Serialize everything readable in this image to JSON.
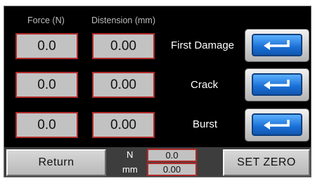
{
  "headers": {
    "force": "Force (N)",
    "distension": "Distension (mm)"
  },
  "rows": [
    {
      "force": "0.0",
      "distension": "0.00",
      "label": "First Damage"
    },
    {
      "force": "0.0",
      "distension": "0.00",
      "label": "Crack"
    },
    {
      "force": "0.0",
      "distension": "0.00",
      "label": "Burst"
    }
  ],
  "enter_icon": "enter-arrow-icon",
  "footer": {
    "return_label": "Return",
    "live_force_unit": "N",
    "live_force_value": "0.0",
    "live_distension_unit": "mm",
    "live_distension_value": "0.00",
    "set_zero_label": "SET ZERO"
  },
  "colors": {
    "background": "#000000",
    "field": "#c2c2c2",
    "field_border": "#b02a2a",
    "button_blue": "#1a6fd6",
    "bottom_bar": "#3d3d3d"
  }
}
